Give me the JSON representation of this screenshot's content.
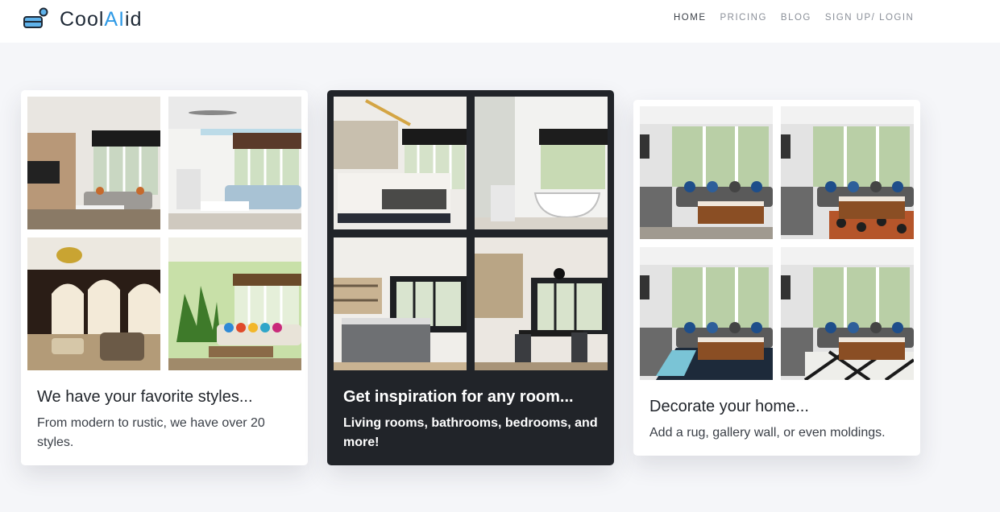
{
  "header": {
    "brand_prefix": "Cool",
    "brand_ai": "AI",
    "brand_suffix": "id",
    "nav": [
      "HOME",
      "PRICING",
      "BLOG",
      "SIGN UP/ LOGIN"
    ],
    "active": "HOME"
  },
  "cards": [
    {
      "title": "We have your favorite styles...",
      "description": "From modern to rustic, we have over 20 styles.",
      "images": [
        "modern-living-room",
        "coastal-living-room",
        "classic-lounge",
        "tropical-living-room"
      ]
    },
    {
      "title": "Get inspiration for any room...",
      "description": "Living rooms, bathrooms, bedrooms, and more!",
      "images": [
        "bedroom",
        "bathroom",
        "kitchen",
        "dining-room"
      ]
    },
    {
      "title": "Decorate your home...",
      "description": "Add a rug, gallery wall, or even moldings.",
      "images": [
        "living-room-plain",
        "living-room-patterned-rug",
        "living-room-blue-rug",
        "living-room-geometric-rug"
      ]
    }
  ],
  "colors": {
    "accent": "#2f9ae6",
    "dark_card": "#212429",
    "background": "#f5f6f9"
  }
}
